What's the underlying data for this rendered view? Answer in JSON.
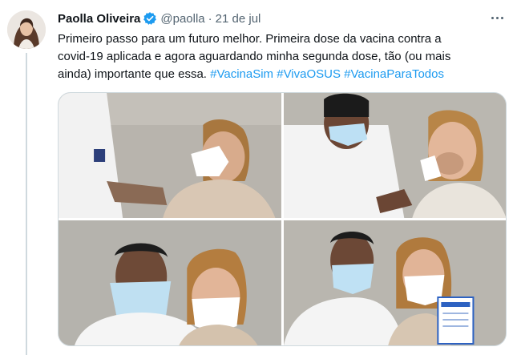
{
  "tweet": {
    "author_name": "Paolla Oliveira",
    "handle": "@paolla",
    "separator": "·",
    "date": "21 de jul",
    "text_lines": [
      "Primeiro passo para um futuro melhor. Primeira dose da vacina contra a",
      "covid-19 aplicada e agora aguardando minha segunda dose, tão (ou mais"
    ],
    "text_line3_prefix": "ainda) importante que essa.",
    "hashtags": [
      "#VacinaSim",
      "#VivaOSUS",
      "#VacinaParaTodos"
    ]
  },
  "icons": {
    "verified": "verified-badge-icon",
    "more": "more-options-icon"
  },
  "colors": {
    "link": "#1d9bf0",
    "secondary_text": "#536471",
    "border": "#cfd9de"
  }
}
